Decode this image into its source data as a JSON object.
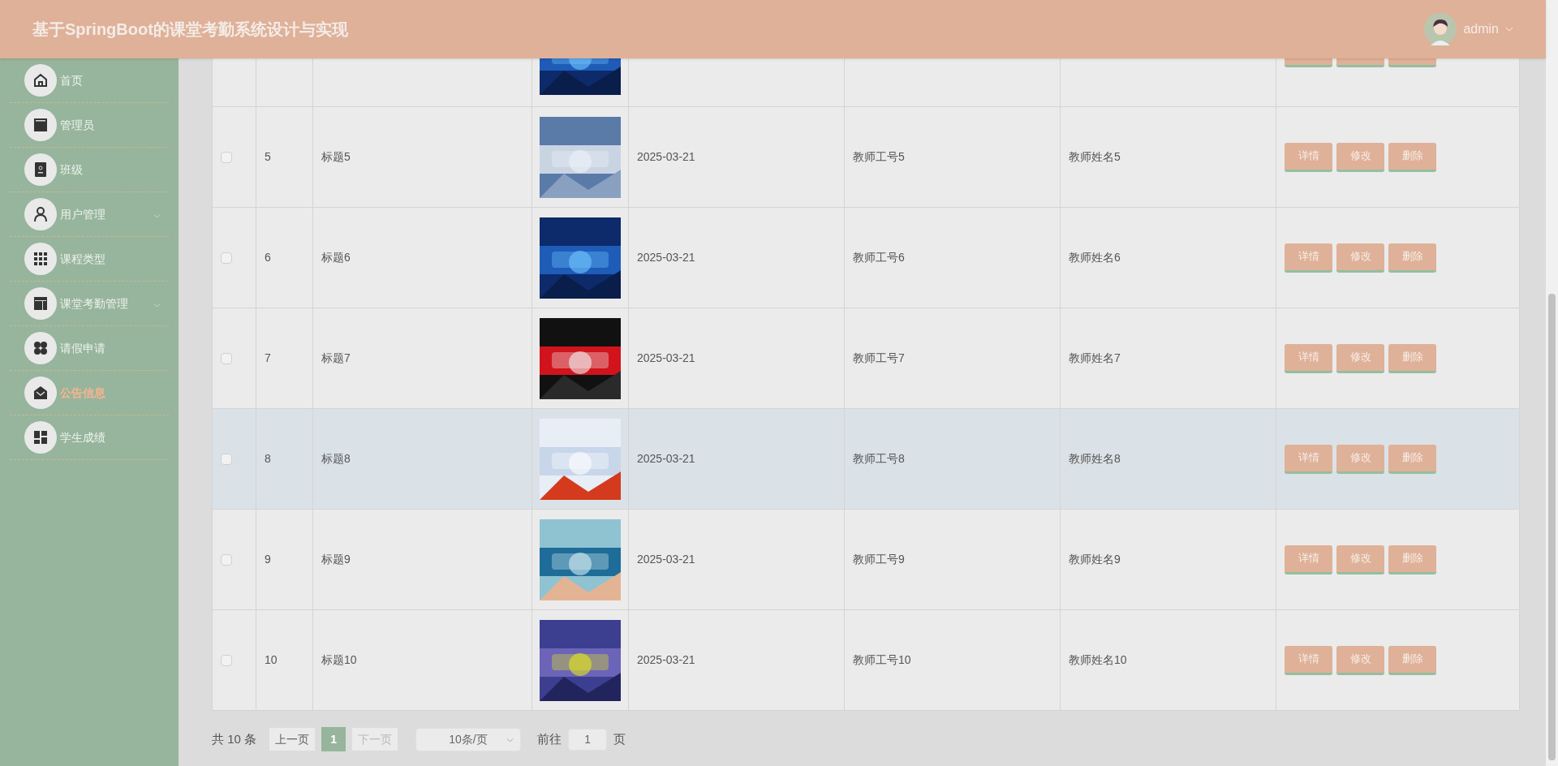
{
  "header": {
    "title": "基于SpringBoot的课堂考勤系统设计与实现",
    "user": "admin"
  },
  "sidebar": {
    "items": [
      {
        "label": "首页",
        "expandable": false,
        "selected": false
      },
      {
        "label": "管理员",
        "expandable": false,
        "selected": false
      },
      {
        "label": "班级",
        "expandable": false,
        "selected": false
      },
      {
        "label": "用户管理",
        "expandable": true,
        "selected": false
      },
      {
        "label": "课程类型",
        "expandable": false,
        "selected": false
      },
      {
        "label": "课堂考勤管理",
        "expandable": true,
        "selected": false
      },
      {
        "label": "请假申请",
        "expandable": false,
        "selected": false
      },
      {
        "label": "公告信息",
        "expandable": false,
        "selected": true
      },
      {
        "label": "学生成绩",
        "expandable": false,
        "selected": false
      }
    ]
  },
  "table": {
    "rows": [
      {
        "index": "5",
        "title": "标题5",
        "date": "2025-03-21",
        "teacher_id": "教师工号5",
        "teacher_name": "教师姓名5",
        "checked": false,
        "highlighted": false,
        "actions": [
          "详情",
          "修改",
          "删除"
        ]
      },
      {
        "index": "6",
        "title": "标题6",
        "date": "2025-03-21",
        "teacher_id": "教师工号6",
        "teacher_name": "教师姓名6",
        "checked": false,
        "highlighted": false,
        "actions": [
          "详情",
          "修改",
          "删除"
        ]
      },
      {
        "index": "7",
        "title": "标题7",
        "date": "2025-03-21",
        "teacher_id": "教师工号7",
        "teacher_name": "教师姓名7",
        "checked": false,
        "highlighted": false,
        "actions": [
          "详情",
          "修改",
          "删除"
        ]
      },
      {
        "index": "8",
        "title": "标题8",
        "date": "2025-03-21",
        "teacher_id": "教师工号8",
        "teacher_name": "教师姓名8",
        "checked": false,
        "highlighted": true,
        "actions": [
          "详情",
          "修改",
          "删除"
        ]
      },
      {
        "index": "9",
        "title": "标题9",
        "date": "2025-03-21",
        "teacher_id": "教师工号9",
        "teacher_name": "教师姓名9",
        "checked": false,
        "highlighted": false,
        "actions": [
          "详情",
          "修改",
          "删除"
        ]
      },
      {
        "index": "10",
        "title": "标题10",
        "date": "2025-03-21",
        "teacher_id": "教师工号10",
        "teacher_name": "教师姓名10",
        "checked": false,
        "highlighted": false,
        "actions": [
          "详情",
          "修改",
          "删除"
        ]
      }
    ]
  },
  "pagination": {
    "total": "共 10 条",
    "prev": "上一页",
    "pages": [
      {
        "label": "1",
        "selected": true
      }
    ],
    "next": "下一页",
    "next_disabled": true,
    "page_size": "10条/页",
    "goto_label": "前往",
    "goto_value": "1",
    "goto_suffix": "页"
  }
}
